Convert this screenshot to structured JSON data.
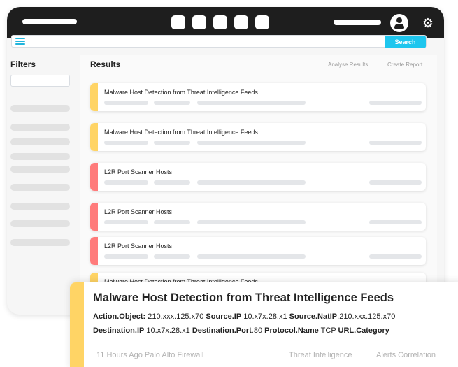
{
  "colors": {
    "accent": "#1ec6ee",
    "titlebar": "#1e1e1e",
    "severity_medium": "#ffd465",
    "severity_high": "#ff7b7b"
  },
  "titlebar": {
    "avatar_icon": "user-icon",
    "settings_icon": "gear-icon"
  },
  "search": {
    "menu_icon": "hamburger-icon",
    "button_label": "Search",
    "value": ""
  },
  "filters": {
    "title": "Filters"
  },
  "results": {
    "title": "Results",
    "analyse_label": "Analyse Results",
    "report_label": "Create Report",
    "items": [
      {
        "title": "Malware Host Detection from Threat Intelligence Feeds",
        "severity": "medium"
      },
      {
        "title": "Malware Host Detection from Threat Intelligence Feeds",
        "severity": "medium"
      },
      {
        "title": "L2R Port Scanner Hosts",
        "severity": "high"
      },
      {
        "title": "L2R Port Scanner Hosts",
        "severity": "high"
      },
      {
        "title": "L2R Port Scanner Hosts",
        "severity": "high"
      },
      {
        "title": "Malware Host Detection from Threat Intelligence Feeds",
        "severity": "medium"
      }
    ]
  },
  "detail": {
    "title": "Malware Host Detection from Threat Intelligence Feeds",
    "fields": {
      "action_object_label": "Action.Object:",
      "action_object_value": "210.xxx.125.x70",
      "source_ip_label": "Source.IP",
      "source_ip_value": "10.x7x.28.x1",
      "source_natip_label": "Source.NatIP",
      "source_natip_value": ".210.xxx.125.x70",
      "destination_ip_label": "Destination.IP",
      "destination_ip_value": "10.x7x.28.x1",
      "destination_port_label": "Destination.Port",
      "destination_port_value": ".80",
      "protocol_name_label": "Protocol.Name",
      "protocol_name_value": "TCP",
      "url_category_label": "URL.Category"
    },
    "footer": {
      "time_source": "11 Hours Ago Palo Alto Firewall",
      "tag_1": "Threat Intelligence",
      "tag_2": "Alerts Correlation"
    }
  }
}
